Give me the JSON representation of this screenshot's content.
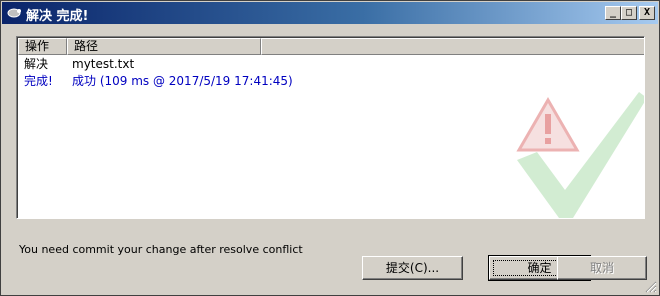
{
  "window": {
    "title": "解决 完成!",
    "buttons": {
      "minimize": "_",
      "maximize": "□",
      "close": "X"
    }
  },
  "list": {
    "columns": [
      "操作",
      "路径"
    ],
    "rows": [
      {
        "action": "解决",
        "path": "mytest.txt",
        "color": "#000000"
      },
      {
        "action": "完成!",
        "path": "成功 (109 ms @ 2017/5/19 17:41:45)",
        "color": "#0000c0"
      }
    ]
  },
  "status": {
    "message": "You need commit your change after resolve conflict"
  },
  "footer": {
    "commit_label": "提交(C)...",
    "ok_label": "确定",
    "cancel_label": "取消"
  },
  "icons": [
    "app-icon",
    "warning-checkmark-watermark-icon",
    "resize-grip-icon"
  ]
}
